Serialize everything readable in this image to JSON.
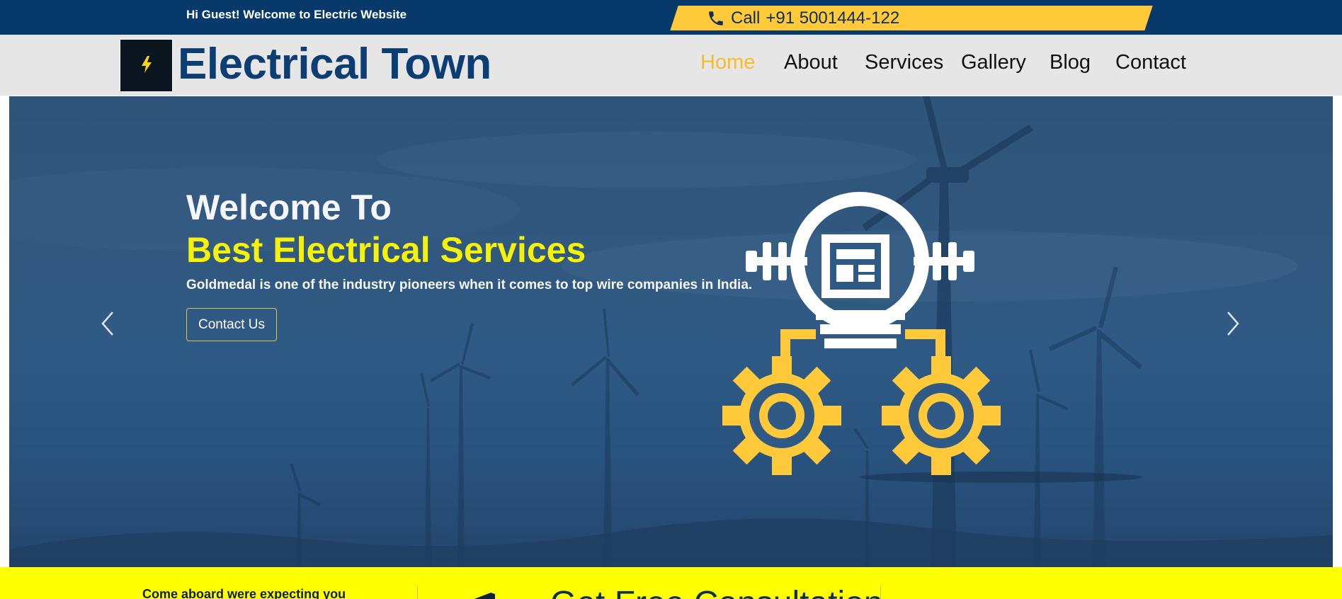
{
  "topbar": {
    "welcome": "Hi Guest! Welcome to Electric Website",
    "call_label": "Call",
    "phone": "+91 5001444-122",
    "phone_icon": "phone-icon"
  },
  "header": {
    "logo_icon": "lightning-bolt-icon",
    "brand": "Electrical Town"
  },
  "nav": {
    "items": [
      {
        "label": "Home",
        "active": true
      },
      {
        "label": "About",
        "active": false
      },
      {
        "label": "Services",
        "active": false
      },
      {
        "label": "Gallery",
        "active": false
      },
      {
        "label": "Blog",
        "active": false
      },
      {
        "label": "Contact",
        "active": false
      }
    ]
  },
  "hero": {
    "title_line1": "Welcome To",
    "title_line2": "Best Electrical Services",
    "subtitle": "Goldmedal is one of the industry pioneers when it comes to top wire companies in India.",
    "button_label": "Contact Us",
    "prev_icon": "chevron-left-icon",
    "next_icon": "chevron-right-icon",
    "illustration_icon": "electric-meter-gears-icon"
  },
  "band": {
    "text": "Come aboard were expecting you",
    "title": "Get Free Consultation"
  },
  "colors": {
    "navy": "#073a6b",
    "accent_yellow": "#ffc93a",
    "active_nav": "#f5bd2c",
    "hero_highlight": "#f5f10b",
    "band_yellow": "#ffff00"
  }
}
